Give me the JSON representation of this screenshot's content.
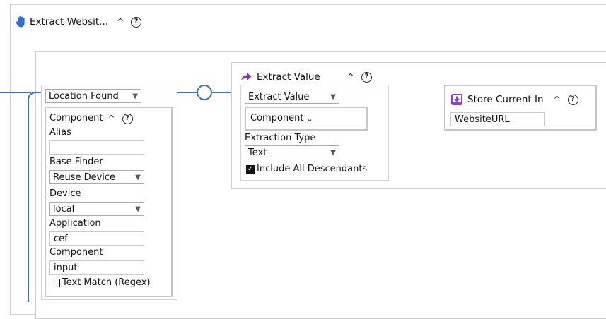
{
  "header": {
    "title": "Extract Websit...",
    "caret": "^",
    "help": "?"
  },
  "location_found": {
    "select_label": "Location Found",
    "component": {
      "title": "Component",
      "caret": "^",
      "help": "?",
      "alias_label": "Alias",
      "alias_value": "",
      "base_finder_label": "Base Finder",
      "base_finder_value": "Reuse Device",
      "device_label": "Device",
      "device_value": "local",
      "application_label": "Application",
      "application_value": "cef",
      "component_label": "Component",
      "component_value": "input",
      "text_match_label": "Text Match (Regex)"
    }
  },
  "extract_value": {
    "title": "Extract Value",
    "caret": "^",
    "help": "?",
    "select_value": "Extract Value",
    "component_value": "Component",
    "extraction_type_label": "Extraction Type",
    "extraction_type_value": "Text",
    "include_descendants_label": "Include All Descendants"
  },
  "store": {
    "title": "Store Current In",
    "caret": "^",
    "help": "?",
    "value": "WebsiteURL"
  },
  "colors": {
    "blue_line": "#3f6fb5",
    "purple_line": "#8a3fc7",
    "hand_icon": "#2b6fd6",
    "arrow_icon": "#7b35c4",
    "store_icon": "#8a3fc7"
  }
}
